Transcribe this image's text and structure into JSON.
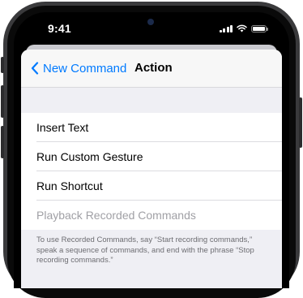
{
  "status_bar": {
    "time": "9:41"
  },
  "nav": {
    "back_label": "New Command",
    "title": "Action"
  },
  "actions": [
    {
      "label": "Insert Text",
      "enabled": true
    },
    {
      "label": "Run Custom Gesture",
      "enabled": true
    },
    {
      "label": "Run Shortcut",
      "enabled": true
    },
    {
      "label": "Playback Recorded Commands",
      "enabled": false
    }
  ],
  "footer_note": "To use Recorded Commands, say “Start recording commands,” speak a sequence of commands, and end with the phrase “Stop recording commands.”",
  "colors": {
    "accent": "#007aff",
    "disabled_text": "#a0a0a5",
    "background": "#efeff4"
  },
  "icons": {
    "back": "chevron-left-icon",
    "signal": "cellular-signal-icon",
    "wifi": "wifi-icon",
    "battery": "battery-icon"
  }
}
